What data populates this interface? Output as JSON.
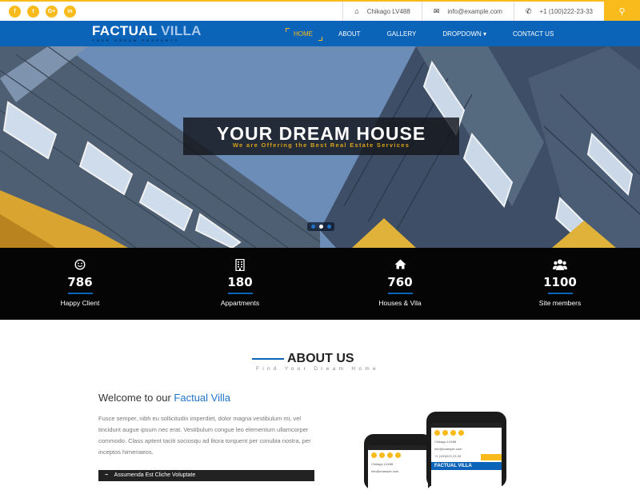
{
  "topbar": {
    "social": [
      {
        "icon": "facebook-icon",
        "glyph": "f"
      },
      {
        "icon": "twitter-icon",
        "glyph": "t"
      },
      {
        "icon": "google-plus-icon",
        "glyph": "G+"
      },
      {
        "icon": "linkedin-icon",
        "glyph": "in"
      }
    ],
    "address": "Chikago LV488",
    "email": "info@example.com",
    "phone": "+1 (100)222-23-33",
    "search_glyph": "⚲"
  },
  "nav": {
    "brand_part1": "FACTUAL",
    "brand_part2": "VILLA",
    "tagline": "Your Dream Property",
    "items": [
      {
        "label": "HOME",
        "active": true
      },
      {
        "label": "ABOUT"
      },
      {
        "label": "GALLERY"
      },
      {
        "label": "DROPDOWN ▾"
      },
      {
        "label": "CONTACT US"
      }
    ]
  },
  "hero": {
    "title": "YOUR DREAM HOUSE",
    "subtitle": "We are Offering the Best Real Estate Services",
    "slides": 3,
    "active_slide": 2
  },
  "stats": [
    {
      "icon": "smile-icon",
      "value": "786",
      "label": "Happy Client"
    },
    {
      "icon": "building-icon",
      "value": "180",
      "label": "Appartments"
    },
    {
      "icon": "home-icon",
      "value": "760",
      "label": "Houses & Vila"
    },
    {
      "icon": "users-icon",
      "value": "1100",
      "label": "Site members"
    }
  ],
  "about": {
    "title": "ABOUT US",
    "subtitle": "Find Your Dream Home",
    "welcome_prefix": "Welcome to our ",
    "welcome_highlight": "Factual Villa",
    "paragraph": "Fusce semper, nibh eu sollicitudin imperdiet, dolor magna vestibulum mi, vel tincidunt augue ipsum nec erat. Vestibulum congue leo elementum ullamcorper commodo. Class aptent taciti sociosqu ad litora torquent per conubia nostra, per inceptos himenaeos.",
    "accordion_label": "Assumenda Est Cliche Voluptate",
    "accordion_glyph": "−"
  },
  "phone_preview": {
    "address": "Chikago LV488",
    "email": "info@example.com",
    "phone": "+1 (100)222-23-33",
    "brand": "FACTUAL VILLA"
  },
  "colors": {
    "brand_blue": "#0b64b8",
    "accent_yellow": "#f9bb1b",
    "dark": "#050505"
  }
}
